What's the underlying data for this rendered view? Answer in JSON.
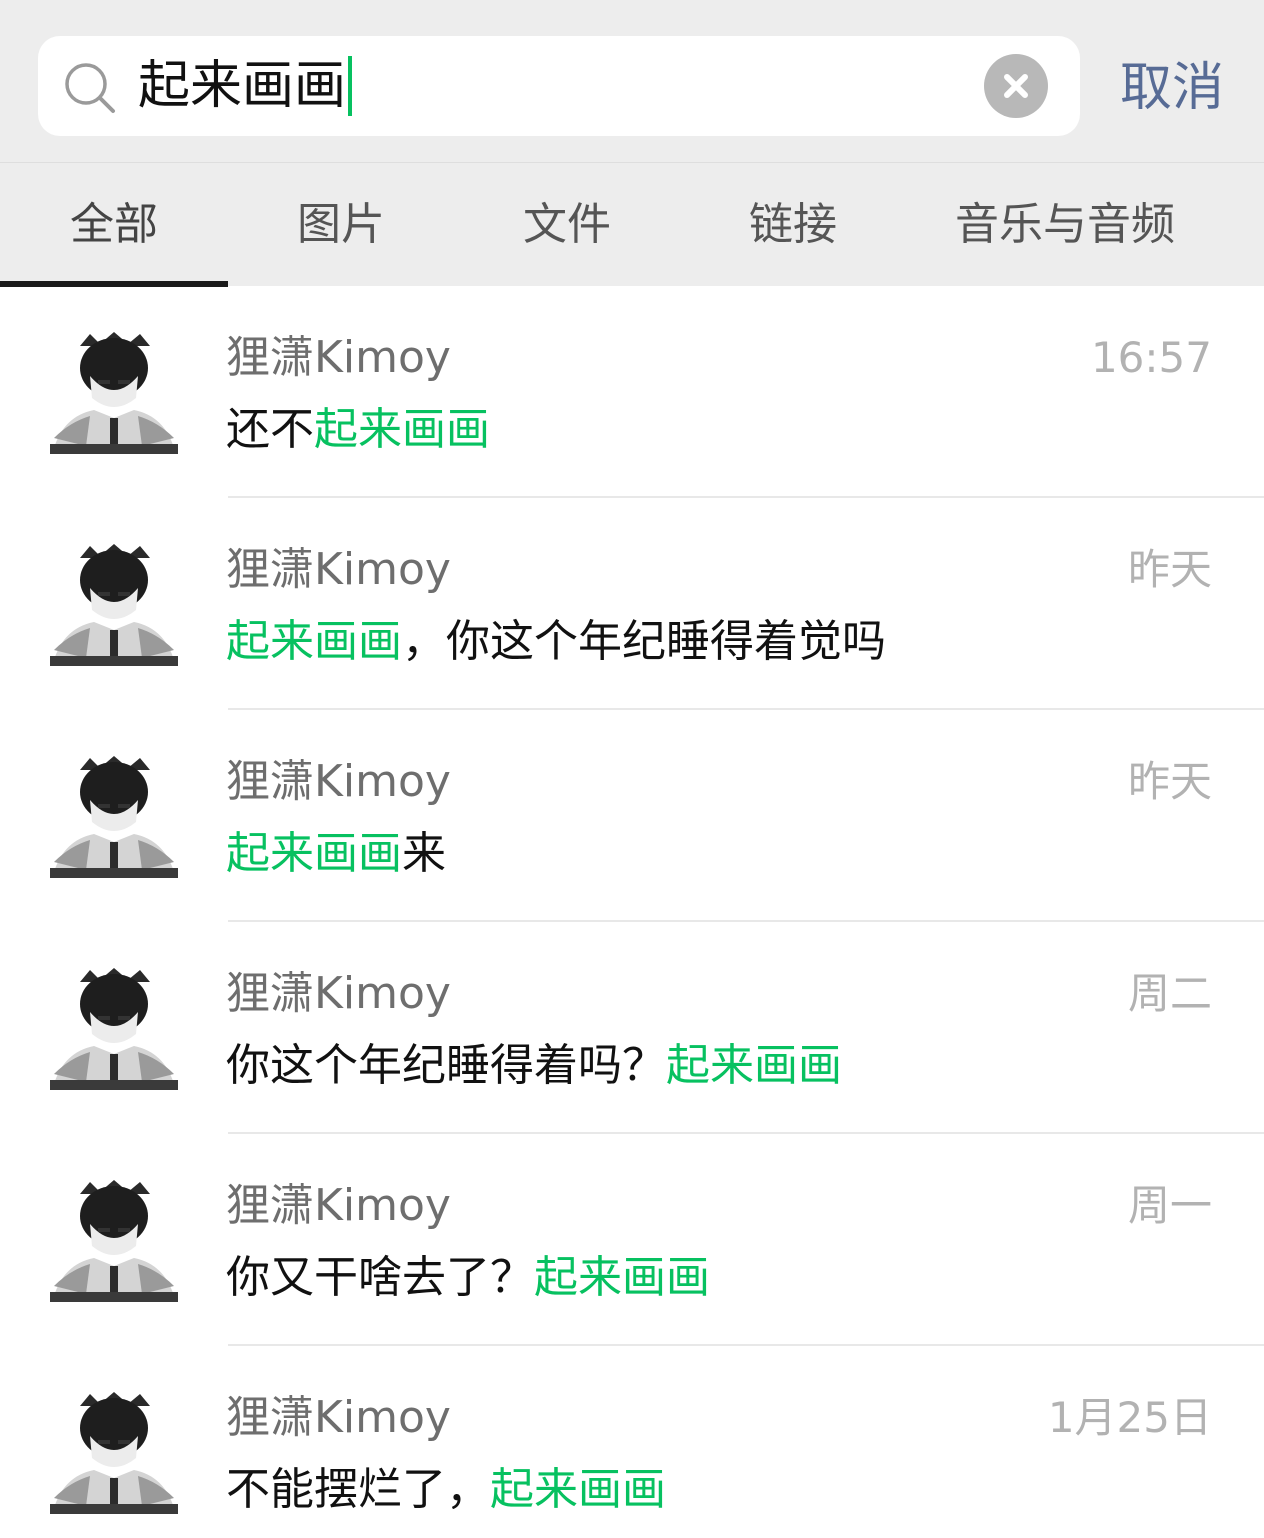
{
  "search": {
    "query": "起来画画",
    "cancel_label": "取消"
  },
  "tabs": [
    {
      "label": "全部",
      "active": true
    },
    {
      "label": "图片",
      "active": false
    },
    {
      "label": "文件",
      "active": false
    },
    {
      "label": "链接",
      "active": false
    },
    {
      "label": "音乐与音频",
      "active": false
    }
  ],
  "colors": {
    "highlight": "#07c160",
    "cancel": "#576b95",
    "background": "#ededed"
  },
  "results": [
    {
      "sender": "狸潇Kimoy",
      "time": "16:57",
      "pre": "还不",
      "hl": "起来画画",
      "post": ""
    },
    {
      "sender": "狸潇Kimoy",
      "time": "昨天",
      "pre": "",
      "hl": "起来画画",
      "post": "，你这个年纪睡得着觉吗"
    },
    {
      "sender": "狸潇Kimoy",
      "time": "昨天",
      "pre": "",
      "hl": "起来画画",
      "post": "来"
    },
    {
      "sender": "狸潇Kimoy",
      "time": "周二",
      "pre": "你这个年纪睡得着吗？",
      "hl": "起来画画",
      "post": ""
    },
    {
      "sender": "狸潇Kimoy",
      "time": "周一",
      "pre": "你又干啥去了？",
      "hl": "起来画画",
      "post": ""
    },
    {
      "sender": "狸潇Kimoy",
      "time": "1月25日",
      "pre": "不能摆烂了，",
      "hl": "起来画画",
      "post": ""
    }
  ]
}
